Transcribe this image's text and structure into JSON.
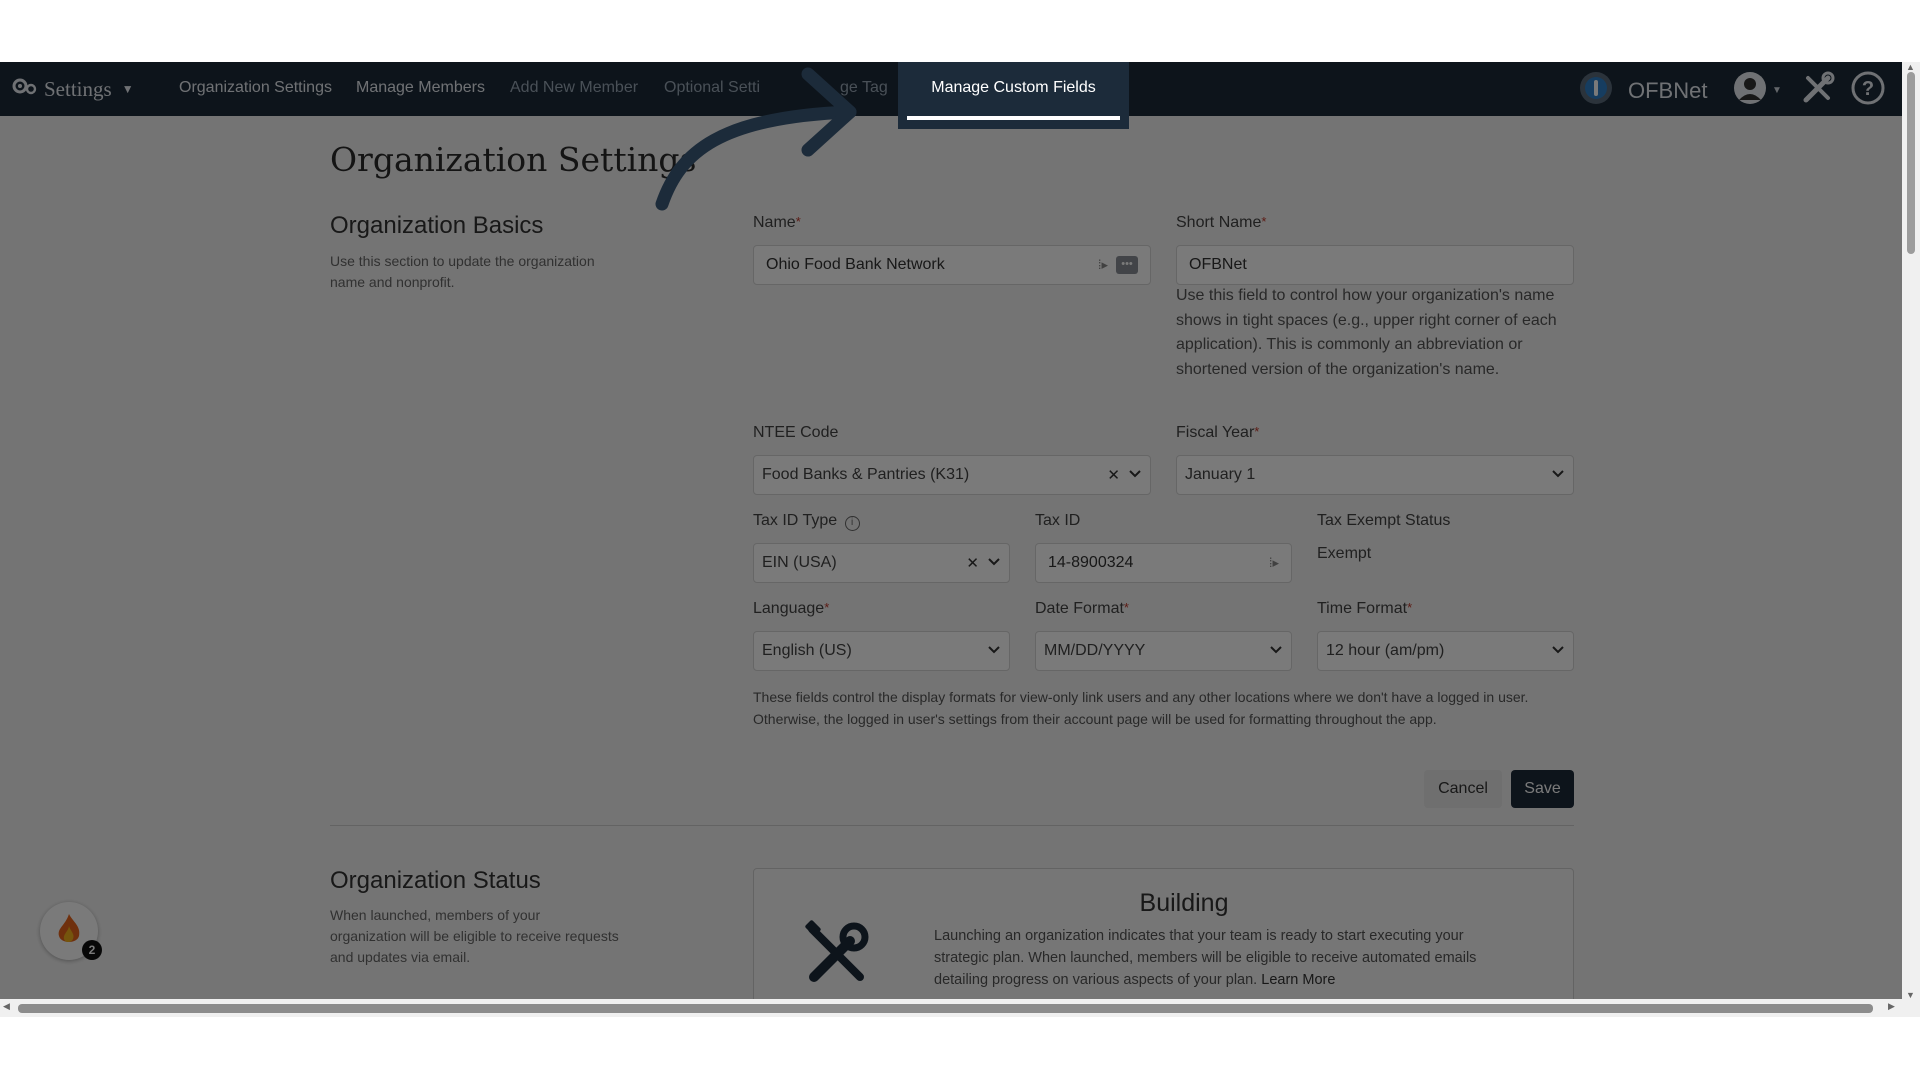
{
  "nav": {
    "settings_label": "Settings",
    "links": [
      "Organization Settings",
      "Manage Members",
      "Add New Member",
      "Optional Setti",
      "ge Tag"
    ],
    "highlight_label": "Manage Custom Fields",
    "org_short_name": "OFBNet"
  },
  "page": {
    "title": "Organization Settings"
  },
  "basics": {
    "title": "Organization Basics",
    "description": "Use this section to update the organization name and nonprofit.",
    "name_label": "Name",
    "name_value": "Ohio Food Bank Network",
    "short_name_label": "Short Name",
    "short_name_value": "OFBNet",
    "short_name_help": "Use this field to control how your organization's name shows in tight spaces (e.g., upper right corner of each application). This is commonly an abbreviation or shortened version of the organization's name.",
    "ntee_label": "NTEE Code",
    "ntee_value": "Food Banks & Pantries (K31)",
    "fiscal_label": "Fiscal Year",
    "fiscal_value": "January 1",
    "taxid_type_label": "Tax ID Type",
    "taxid_type_value": "EIN (USA)",
    "taxid_label": "Tax ID",
    "taxid_value": "14-8900324",
    "tax_exempt_label": "Tax Exempt Status",
    "tax_exempt_value": "Exempt",
    "language_label": "Language",
    "language_value": "English (US)",
    "date_format_label": "Date Format",
    "date_format_value": "MM/DD/YYYY",
    "time_format_label": "Time Format",
    "time_format_value": "12 hour (am/pm)",
    "format_note": "These fields control the display formats for view-only link users and any other locations where we don't have a logged in user. Otherwise, the logged in user's settings from their account page will be used for formatting throughout the app.",
    "cancel_label": "Cancel",
    "save_label": "Save"
  },
  "status": {
    "title": "Organization Status",
    "description": "When launched, members of your organization will be eligible to receive requests and updates via email.",
    "card_title": "Building",
    "card_desc": "Launching an organization indicates that your team is ready to start executing your strategic plan. When launched, members will be eligible to receive automated emails detailing progress on various aspects of your plan.",
    "learn_more": "Learn More"
  },
  "notifications": {
    "count": "2"
  },
  "colors": {
    "navbar": "#1c2b3a",
    "required": "#c0392b",
    "primary_button": "#1c2b3a"
  }
}
